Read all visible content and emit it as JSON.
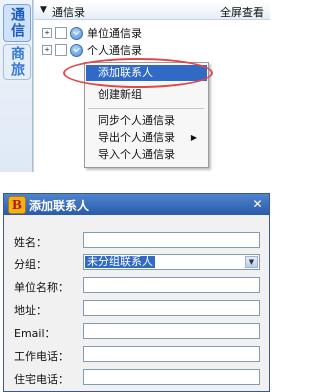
{
  "sidebar": {
    "tabs": [
      {
        "label": "通信",
        "active": true
      },
      {
        "label": "商旅",
        "active": false
      }
    ]
  },
  "header": {
    "title": "通信录",
    "fullscreen_label": "全屏查看"
  },
  "tree": {
    "items": [
      {
        "label": "单位通信录",
        "expander": "+"
      },
      {
        "label": "个人通信录",
        "expander": "+"
      }
    ]
  },
  "context_menu": {
    "items": [
      {
        "label": "添加联系人",
        "highlighted": true
      },
      {
        "label": "创建新组"
      },
      {
        "label": "同步个人通信录"
      },
      {
        "label": "导出个人通信录",
        "has_submenu": true
      },
      {
        "label": "导入个人通信录"
      }
    ],
    "submenu_arrow": "▶",
    "highlight_color": "#e04848"
  },
  "dialog": {
    "title": "添加联系人",
    "icon_letter": "B",
    "close_glyph": "✕",
    "fields": {
      "name": {
        "label": "姓名：",
        "value": ""
      },
      "group": {
        "label": "分组：",
        "value": "未分组联系人"
      },
      "company": {
        "label": "单位名称：",
        "value": ""
      },
      "address": {
        "label": "地址：",
        "value": ""
      },
      "email": {
        "label": "Email：",
        "value": ""
      },
      "work_phone": {
        "label": "工作电话：",
        "value": ""
      },
      "home_phone": {
        "label": "住宅电话：",
        "value": ""
      }
    }
  },
  "colors": {
    "titlebar": "#2a5aa8",
    "selection": "#316ac5",
    "annotation": "#e04848"
  }
}
